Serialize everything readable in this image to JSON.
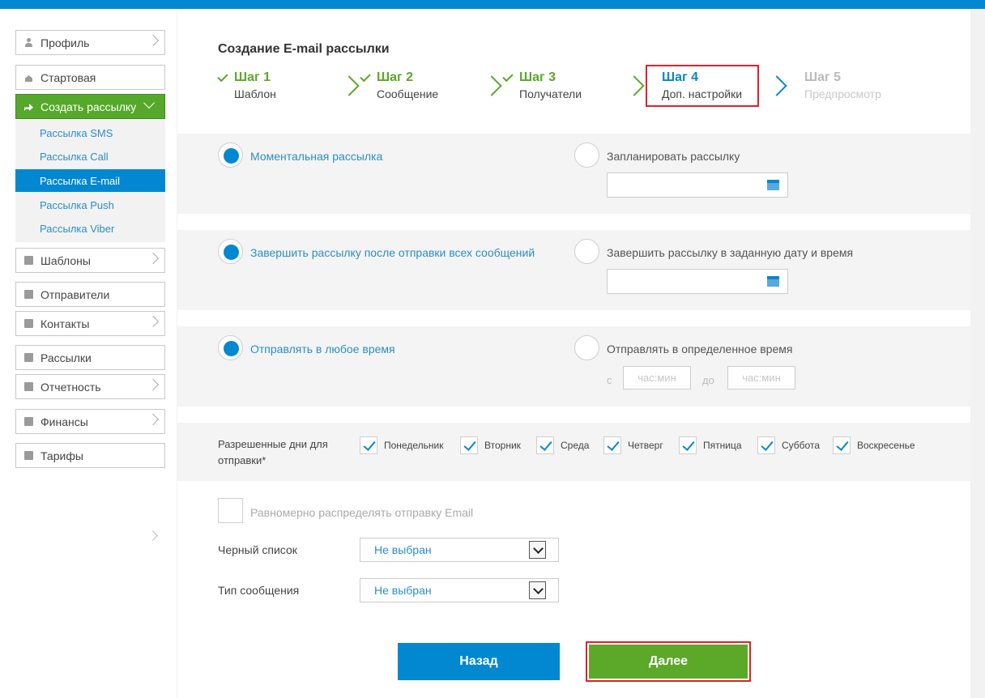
{
  "sidebar": {
    "profile": "Профиль",
    "home": "Стартовая",
    "create": "Создать рассылку",
    "sub": [
      "Рассылка SMS",
      "Рассылка Call",
      "Рассылка E-mail",
      "Рассылка Push",
      "Рассылка Viber"
    ],
    "templates": "Шаблоны",
    "senders": "Отправители",
    "contacts": "Контакты",
    "mailings": "Рассылки",
    "reports": "Отчетность",
    "finance": "Финансы",
    "tariffs": "Тарифы"
  },
  "page": {
    "title": "Создание E-mail рассылки"
  },
  "steps": [
    {
      "title": "Шаг 1",
      "sub": "Шаблон"
    },
    {
      "title": "Шаг 2",
      "sub": "Сообщение"
    },
    {
      "title": "Шаг 3",
      "sub": "Получатели"
    },
    {
      "title": "Шаг 4",
      "sub": "Доп. настройки"
    },
    {
      "title": "Шаг 5",
      "sub": "Предпросмотр"
    }
  ],
  "send_time": {
    "instant": "Моментальная рассылка",
    "scheduled": "Запланировать рассылку"
  },
  "finish": {
    "after_all": "Завершить рассылку после отправки всех сообщений",
    "at_date": "Завершить рассылку в заданную дату и время"
  },
  "window": {
    "anytime": "Отправлять в любое время",
    "specific": "Отправлять в определенное время",
    "from": "с",
    "to": "до",
    "time_placeholder": "час:мин"
  },
  "days": {
    "label_line1": "Разрешенные дни для",
    "label_line2": "отправки*",
    "items": [
      "Понедельник",
      "Вторник",
      "Среда",
      "Четверг",
      "Пятница",
      "Суббота",
      "Воскресенье"
    ]
  },
  "even": "Равномерно распределять отправку Email",
  "blacklist": {
    "label": "Черный список",
    "value": "Не выбран"
  },
  "msg_type": {
    "label": "Тип сообщения",
    "value": "Не выбран"
  },
  "buttons": {
    "back": "Назад",
    "next": "Далее"
  }
}
